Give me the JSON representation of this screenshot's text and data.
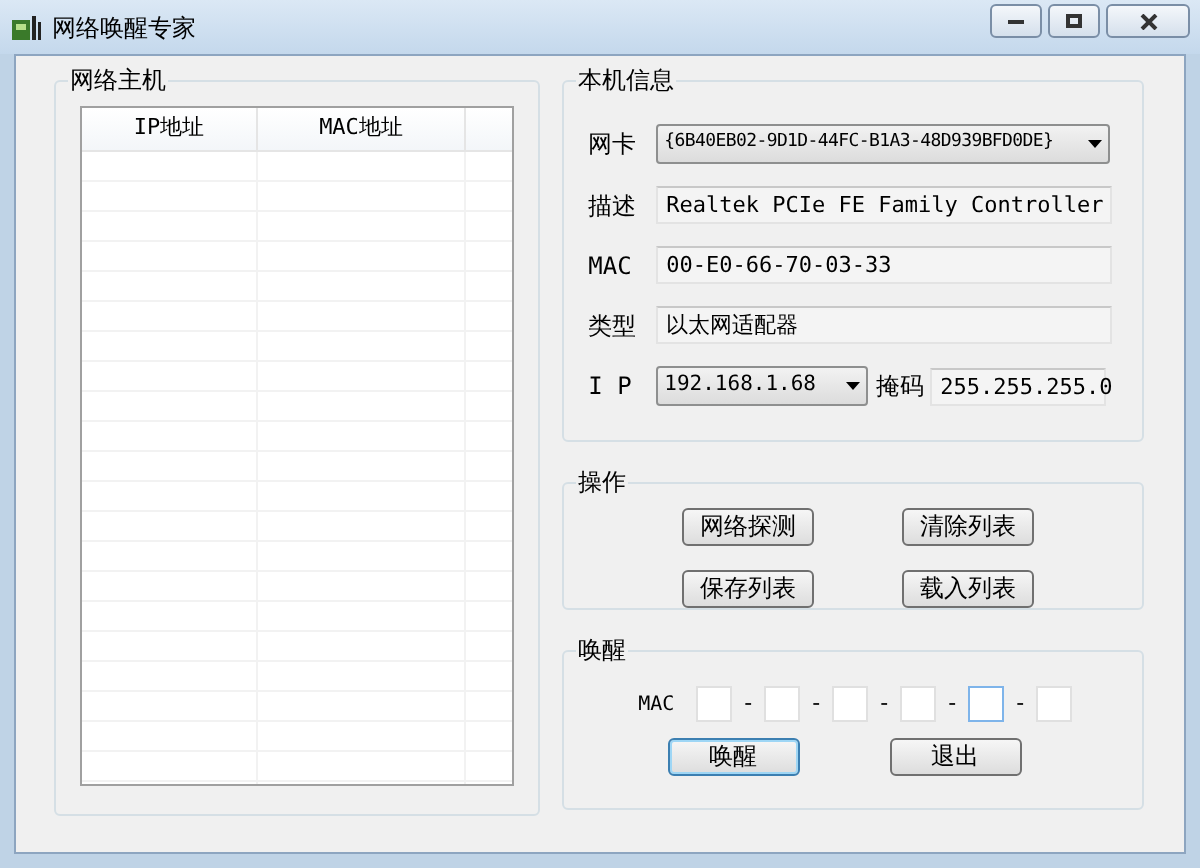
{
  "window": {
    "title": "网络唤醒专家"
  },
  "hosts": {
    "title": "网络主机",
    "columns": [
      "IP地址",
      "MAC地址"
    ]
  },
  "local_info": {
    "title": "本机信息",
    "adapter": {
      "label": "网卡",
      "value": "{6B40EB02-9D1D-44FC-B1A3-48D939BFD0DE}"
    },
    "description": {
      "label": "描述",
      "value": "Realtek PCIe FE Family Controller"
    },
    "mac": {
      "label": "MAC",
      "value": "00-E0-66-70-03-33"
    },
    "type": {
      "label": "类型",
      "value": "以太网适配器"
    },
    "ip": {
      "label": "I P",
      "value": "192.168.1.68"
    },
    "mask": {
      "label": "掩码",
      "value": "255.255.255.0"
    }
  },
  "operations": {
    "title": "操作",
    "buttons": [
      "网络探测",
      "清除列表",
      "保存列表",
      "载入列表"
    ]
  },
  "wake": {
    "title": "唤醒",
    "mac_label": "MAC",
    "separators": [
      "-",
      "-",
      "-",
      "-",
      "-"
    ],
    "mac_fields": [
      {
        "focused": false
      },
      {
        "focused": false
      },
      {
        "focused": false
      },
      {
        "focused": false
      },
      {
        "focused": true
      },
      {
        "focused": false
      }
    ],
    "buttons": [
      {
        "label": "唤醒",
        "focused": true
      },
      {
        "label": "退出",
        "focused": false
      }
    ]
  }
}
